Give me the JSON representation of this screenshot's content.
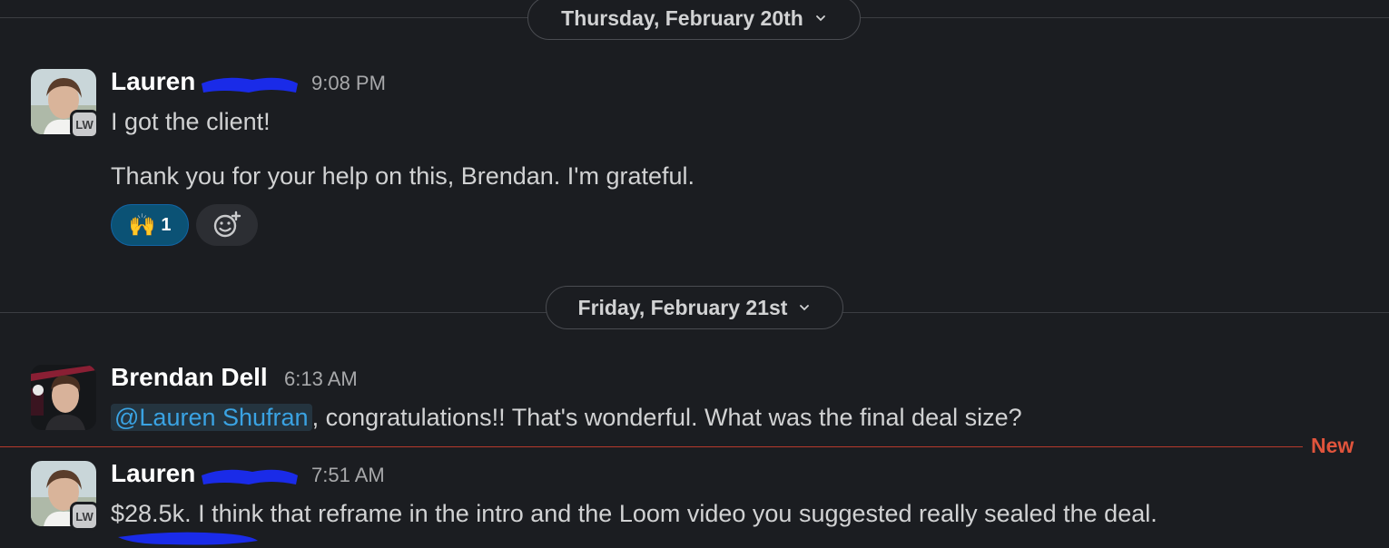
{
  "dates": {
    "first": "Thursday, February 20th",
    "second": "Friday, February 21st"
  },
  "messages": [
    {
      "author": "Lauren Shufran",
      "author_visible": "Lauren",
      "time": "9:08 PM",
      "badge": "LW",
      "lines": [
        "I got the client!",
        "Thank you for your help on this, Brendan. I'm grateful."
      ],
      "reactions": [
        {
          "emoji": "🙌",
          "count": "1"
        }
      ]
    },
    {
      "author": "Brendan Dell",
      "time": "6:13 AM",
      "mention": "@Lauren Shufran",
      "text": ", congratulations!! That's wonderful. What was the final deal size?"
    },
    {
      "author": "Lauren Shufran",
      "author_visible": "Lauren",
      "time": "7:51 AM",
      "badge": "LW",
      "text": "$28.5k. I think that reframe in the intro and the Loom video you suggested really sealed the deal."
    }
  ],
  "new_divider": "New",
  "icons": [
    "chevron-down-icon",
    "raised-hands-emoji",
    "add-reaction-icon"
  ],
  "colors": {
    "background": "#1b1d21",
    "mention": "#3aa3e3",
    "new": "#e0543c",
    "reaction_active": "#0b5275"
  }
}
